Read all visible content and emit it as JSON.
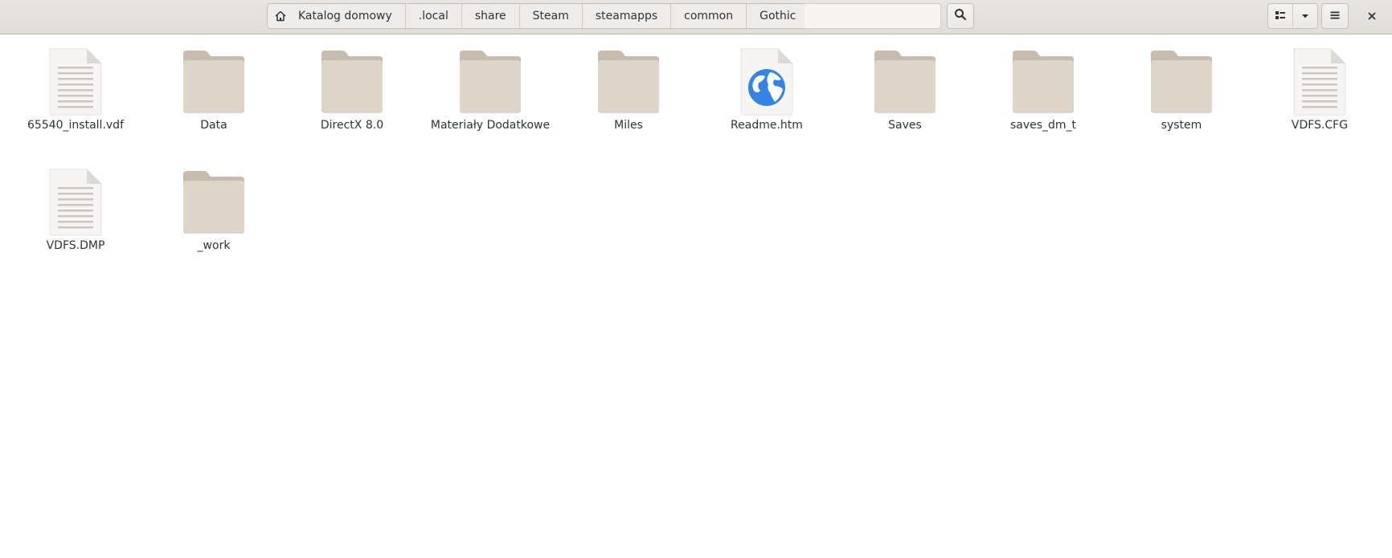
{
  "pathbar": {
    "crumbs": [
      "Katalog domowy",
      ".local",
      "share",
      "Steam",
      "steamapps",
      "common",
      "Gothic"
    ]
  },
  "items": [
    {
      "label": "65540_install.vdf",
      "type": "text-file-icon"
    },
    {
      "label": "Data",
      "type": "folder-icon"
    },
    {
      "label": "DirectX 8.0",
      "type": "folder-icon"
    },
    {
      "label": "Materiały Dodatkowe",
      "type": "folder-icon"
    },
    {
      "label": "Miles",
      "type": "folder-icon"
    },
    {
      "label": "Readme.htm",
      "type": "web-file-icon"
    },
    {
      "label": "Saves",
      "type": "folder-icon"
    },
    {
      "label": "saves_dm_t",
      "type": "folder-icon"
    },
    {
      "label": "system",
      "type": "folder-icon"
    },
    {
      "label": "VDFS.CFG",
      "type": "text-file-icon"
    },
    {
      "label": "VDFS.DMP",
      "type": "text-file-icon"
    },
    {
      "label": "_work",
      "type": "folder-icon"
    }
  ],
  "colors": {
    "folder": "#dcd2c7",
    "folder_tab": "#c8bcae",
    "headerbar": "#e4e2df",
    "globe": "#3584e4"
  }
}
